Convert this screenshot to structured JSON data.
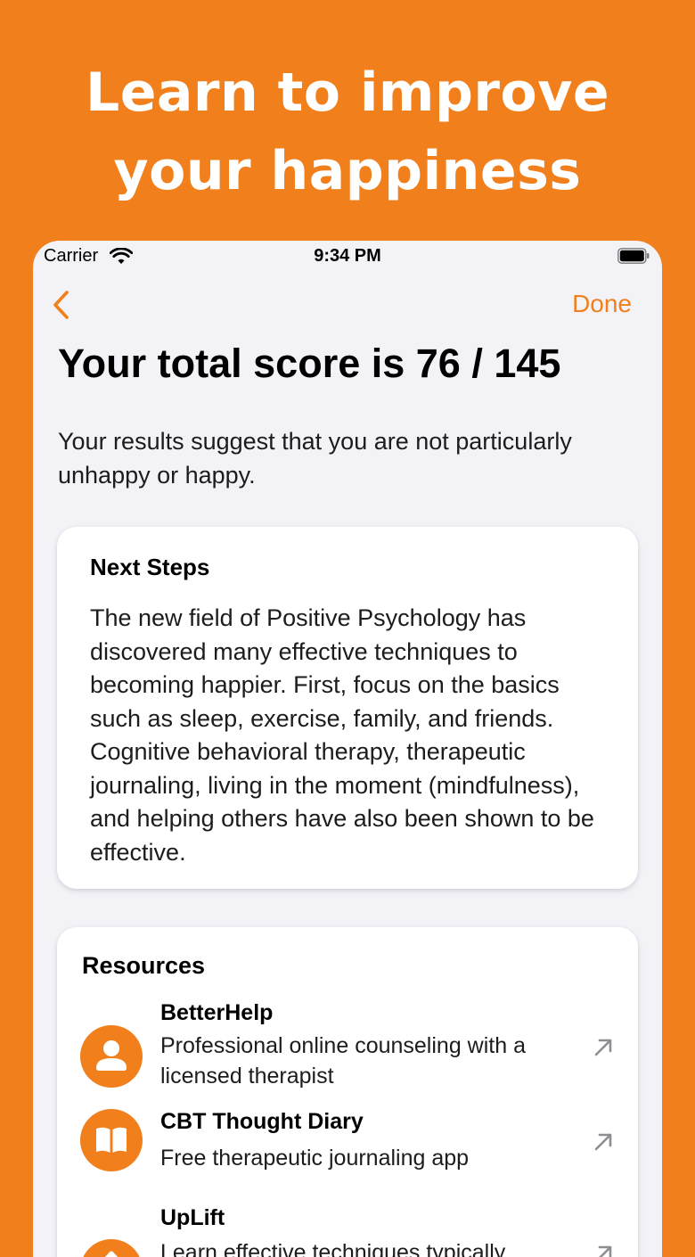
{
  "headline": {
    "line1": "Learn to improve",
    "line2": "your happiness"
  },
  "status_bar": {
    "carrier": "Carrier",
    "time": "9:34 PM"
  },
  "nav": {
    "done_label": "Done"
  },
  "result": {
    "title": "Your total score is 76 / 145",
    "summary": "Your results suggest that you are not particularly unhappy or happy."
  },
  "next_steps": {
    "title": "Next Steps",
    "body": "The new field of Positive Psychology has discovered many effective techniques to becoming happier. First, focus on the basics such as sleep, exercise, family, and friends. Cognitive behavioral therapy, therapeutic journaling, living in the moment (mindfulness), and helping others have also been shown to be effective."
  },
  "resources": {
    "title": "Resources",
    "items": [
      {
        "name": "BetterHelp",
        "description": "Professional online counseling with a licensed therapist",
        "icon": "person-icon"
      },
      {
        "name": "CBT Thought Diary",
        "description": "Free therapeutic journaling app",
        "icon": "book-icon"
      },
      {
        "name": "UpLift",
        "description": "Learn effective techniques typically",
        "icon": "arrow-up-icon"
      }
    ]
  },
  "colors": {
    "accent": "#F1801C",
    "background": "#F2F2F7",
    "card": "#FFFFFF"
  }
}
